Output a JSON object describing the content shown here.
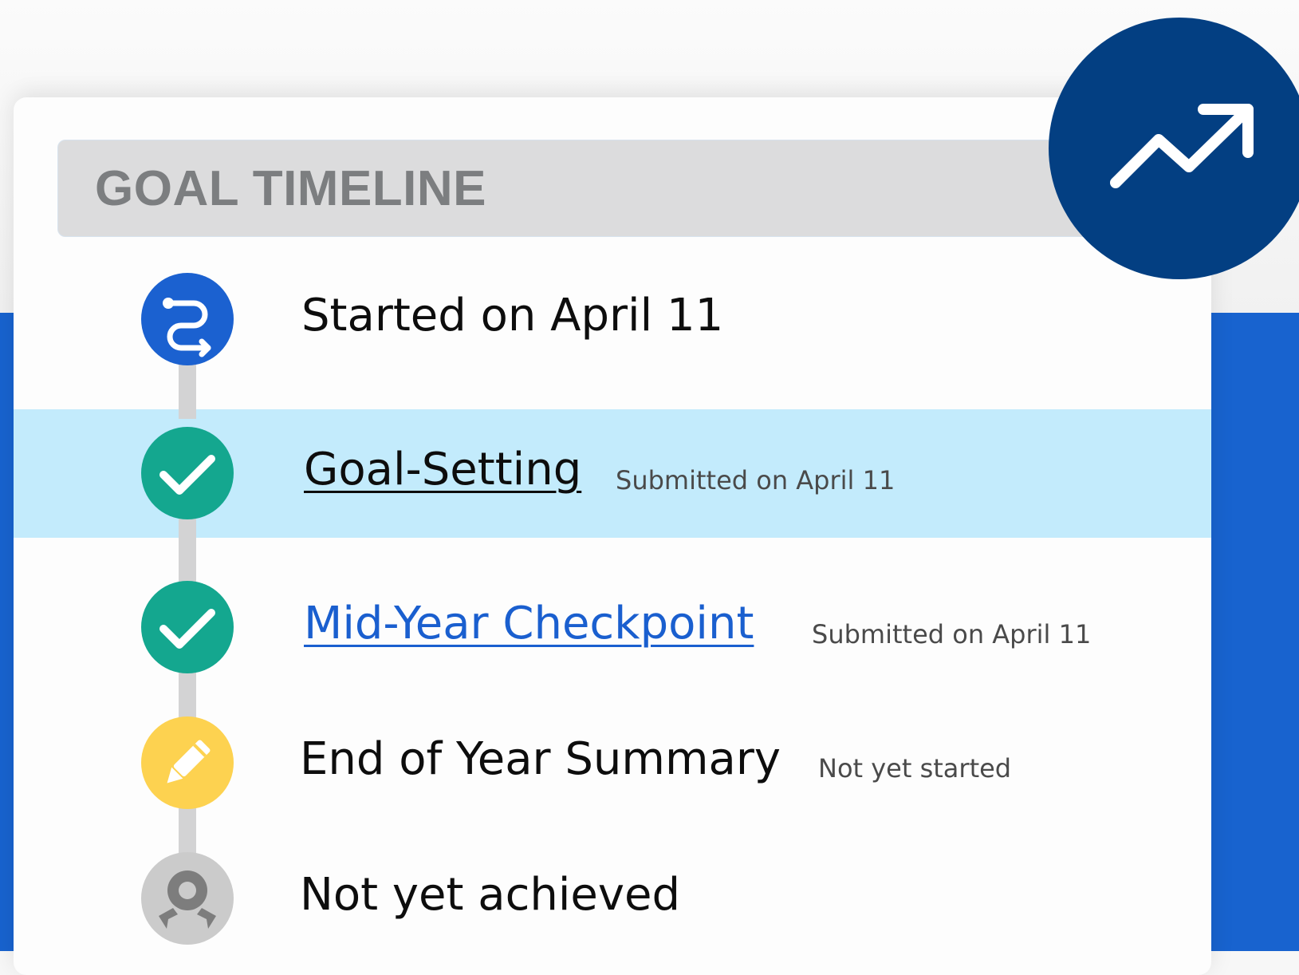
{
  "header": {
    "title": "GOAL TIMELINE"
  },
  "icons": {
    "badge": "trending-up-icon",
    "start": "route-icon",
    "complete": "checkmark-icon",
    "in_progress": "pencil-icon",
    "award": "award-ribbon-icon"
  },
  "colors": {
    "page_blue": "#1863cf",
    "badge_navy": "#033f82",
    "start_blue": "#1b61d0",
    "complete_green": "#14a78f",
    "in_progress_yellow": "#fdd250",
    "pending_gray": "#cbcbcb",
    "highlight_row": "#c3ebfc",
    "link_blue": "#1a5fcf"
  },
  "timeline": {
    "started": {
      "label": "Started on April 11"
    },
    "goal_setting": {
      "label": "Goal-Setting",
      "status": "Submitted on April 11"
    },
    "mid_year": {
      "label": "Mid-Year Checkpoint",
      "status": "Submitted on April 11"
    },
    "end_of_year": {
      "label": "End of Year Summary",
      "status": "Not yet started"
    },
    "achievement": {
      "label": "Not yet achieved"
    }
  }
}
